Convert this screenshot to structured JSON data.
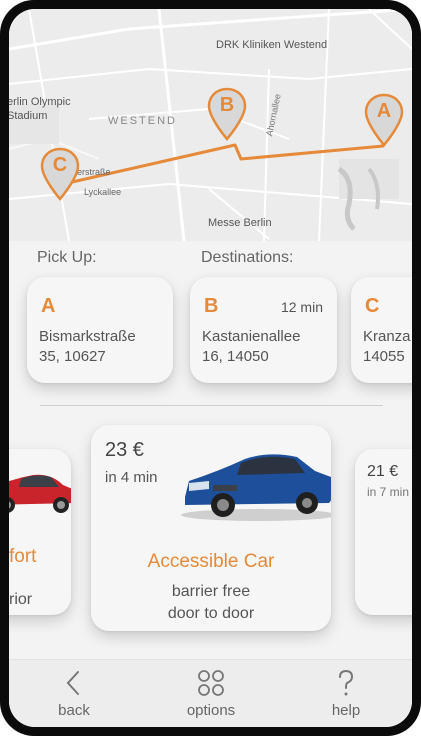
{
  "map": {
    "labels": {
      "drk": "DRK Kliniken Westend",
      "olympic": "erlin Olympic\nStadium",
      "westend": "WESTEND",
      "ahorn": "Ahornallee",
      "strasse": "erstraße",
      "lyck": "Lyckallee",
      "messe": "Messe Berlin"
    },
    "pins": [
      "A",
      "B",
      "C"
    ],
    "route_color": "#e58a3a"
  },
  "pickup": {
    "heading": "Pick Up:",
    "letter": "A",
    "address_line1": "Bismarkstraße",
    "address_line2": "35, 10627"
  },
  "destinations": {
    "heading": "Destinations:",
    "items": [
      {
        "letter": "B",
        "time": "12 min",
        "address_line1": "Kastanienallee",
        "address_line2": "16, 14050"
      },
      {
        "letter": "C",
        "address_line1": "Kranza",
        "address_line2": "14055"
      }
    ]
  },
  "cars": {
    "left": {
      "title_partial": "fort",
      "sub_partial": "rior"
    },
    "center": {
      "price": "23 €",
      "eta": "in 4 min",
      "title": "Accessible Car",
      "subtitle_line1": "barrier free",
      "subtitle_line2": "door to door"
    },
    "right": {
      "price": "21 €",
      "eta": "in 7 min"
    }
  },
  "nav": {
    "back": "back",
    "options": "options",
    "help": "help"
  },
  "colors": {
    "accent": "#e58a3a",
    "background": "#f3f3f3",
    "card": "#f6f6f6"
  }
}
